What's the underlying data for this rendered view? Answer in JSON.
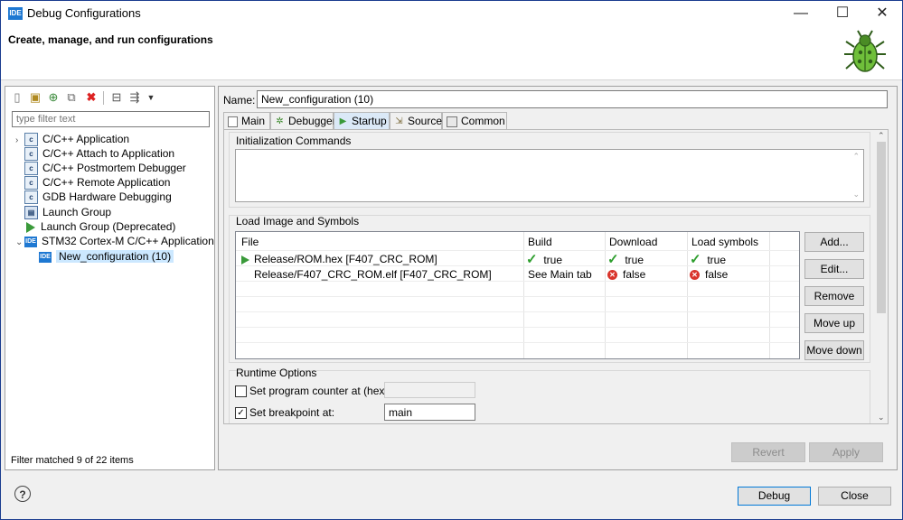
{
  "window": {
    "title": "Debug Configurations",
    "icon_label": "IDE"
  },
  "window_controls": {
    "minimize": "—",
    "maximize": "☐",
    "close": "✕"
  },
  "header": {
    "title": "Create, manage, and run configurations"
  },
  "left": {
    "filter_placeholder": "type filter text",
    "tree": [
      {
        "label": "C/C++ Application",
        "icon": "c-app-icon",
        "expandable": true
      },
      {
        "label": "C/C++ Attach to Application",
        "icon": "c-app-icon"
      },
      {
        "label": "C/C++ Postmortem Debugger",
        "icon": "c-app-icon"
      },
      {
        "label": "C/C++ Remote Application",
        "icon": "c-app-icon"
      },
      {
        "label": "GDB Hardware Debugging",
        "icon": "c-app-icon"
      },
      {
        "label": "Launch Group",
        "icon": "launch-group-icon"
      },
      {
        "label": "Launch Group (Deprecated)",
        "icon": "play-icon"
      },
      {
        "label": "STM32 Cortex-M C/C++ Application",
        "icon": "ide-icon",
        "expanded": true
      },
      {
        "label": "New_configuration (10)",
        "icon": "ide-icon",
        "selected": true
      }
    ],
    "status": "Filter matched 9 of 22 items"
  },
  "right": {
    "name_label": "Name:",
    "name_value": "New_configuration (10)",
    "tabs": [
      "Main",
      "Debugger",
      "Startup",
      "Source",
      "Common"
    ],
    "active_tab": "Startup",
    "init_commands_label": "Initialization Commands",
    "load_image_label": "Load Image and Symbols",
    "table": {
      "headers": [
        "File",
        "Build",
        "Download",
        "Load symbols"
      ],
      "rows": [
        {
          "file": "Release/ROM.hex [F407_CRC_ROM]",
          "build": "true",
          "download": "true",
          "symbols": "true"
        },
        {
          "file": "Release/F407_CRC_ROM.elf [F407_CRC_ROM]",
          "build": "See Main tab",
          "download": "false",
          "symbols": "false"
        }
      ]
    },
    "side_buttons": [
      "Add...",
      "Edit...",
      "Remove",
      "Move up",
      "Move down"
    ],
    "runtime_label": "Runtime Options",
    "pc_label": "Set program counter at (hex):",
    "pc_value": "",
    "bp_label": "Set breakpoint at:",
    "bp_value": "main",
    "revert": "Revert",
    "apply": "Apply"
  },
  "footer": {
    "help": "?",
    "debug": "Debug",
    "close": "Close"
  },
  "colors": {
    "accent": "#0078d7",
    "selection": "#cce8ff",
    "ok": "#2e9e2e",
    "error": "#d9342b"
  }
}
